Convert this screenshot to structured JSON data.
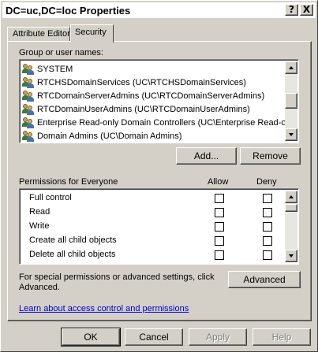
{
  "window": {
    "title": "DC=uc,DC=loc Properties",
    "help_glyph": "?",
    "close_glyph": "X"
  },
  "tabs": [
    {
      "label": "Attribute Editor",
      "selected": false
    },
    {
      "label": "Security",
      "selected": true
    }
  ],
  "security": {
    "group_label": "Group or user names:",
    "users": [
      "SYSTEM",
      "RTCHSDomainServices (UC\\RTCHSDomainServices)",
      "RTCDomainServerAdmins (UC\\RTCDomainServerAdmins)",
      "RTCDomainUserAdmins (UC\\RTCDomainUserAdmins)",
      "Enterprise Read-only Domain Controllers (UC\\Enterprise Read-o...",
      "Domain Admins (UC\\Domain Admins)"
    ],
    "add_label": "Add...",
    "remove_label": "Remove",
    "permissions_label": "Permissions for Everyone",
    "allow_header": "Allow",
    "deny_header": "Deny",
    "permissions": [
      {
        "name": "Full control",
        "allow": false,
        "deny": false
      },
      {
        "name": "Read",
        "allow": false,
        "deny": false
      },
      {
        "name": "Write",
        "allow": false,
        "deny": false
      },
      {
        "name": "Create all child objects",
        "allow": false,
        "deny": false
      },
      {
        "name": "Delete all child objects",
        "allow": false,
        "deny": false
      }
    ],
    "special_text_1": "For special permissions or advanced settings, click",
    "special_text_2": "Advanced.",
    "advanced_label": "Advanced",
    "learn_link": "Learn about access control and permissions"
  },
  "footer": {
    "ok_label": "OK",
    "cancel_label": "Cancel",
    "apply_label": "Apply",
    "help_label": "Help"
  },
  "icons": {
    "user_group": "user-group-icon",
    "scroll_up": "scroll-up-arrow-icon",
    "scroll_down": "scroll-down-arrow-icon"
  },
  "colors": {
    "dialog_face": "#d4d0c8",
    "link": "#0000cc",
    "disabled_text": "#808080"
  }
}
